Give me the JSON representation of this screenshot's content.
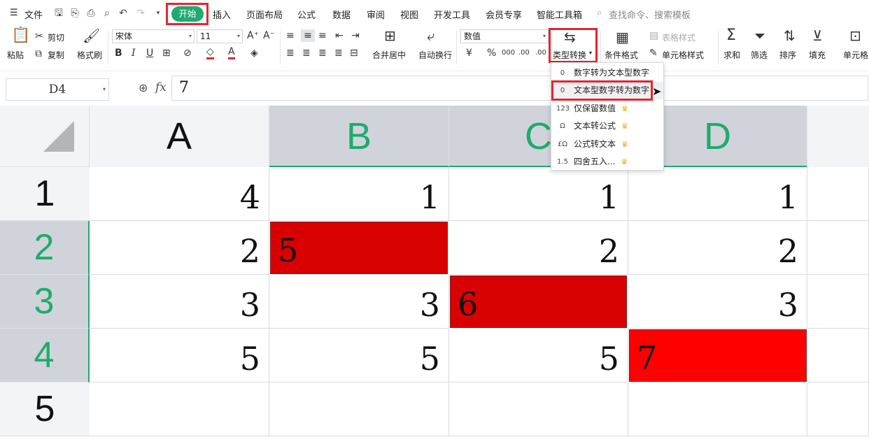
{
  "menubar": {
    "file_label": "文件",
    "tabs": [
      "开始",
      "插入",
      "页面布局",
      "公式",
      "数据",
      "审阅",
      "视图",
      "开发工具",
      "会员专享",
      "智能工具箱"
    ],
    "search_placeholder": "查找命令、搜索模板",
    "accent": "#1fab6d"
  },
  "ribbon": {
    "paste": "粘贴",
    "cut": "剪切",
    "copy": "复制",
    "format_painter": "格式刷",
    "font_name": "宋体",
    "font_size": "11",
    "merge_center": "合并居中",
    "wrap_text": "自动换行",
    "number_format": "数值",
    "currency": "¥",
    "percent": "%",
    "thousands": "000",
    "dec_inc": ".00",
    "dec_dec": ".00",
    "type_convert": "类型转换",
    "cond_format": "条件格式",
    "table_style": "表格样式",
    "cell_style": "单元格样式",
    "sum": "求和",
    "filter": "筛选",
    "sort": "排序",
    "fill": "填充",
    "cell": "单元格"
  },
  "formula_bar": {
    "name_box": "D4",
    "fx": "fx",
    "value": "7"
  },
  "grid": {
    "columns": [
      "A",
      "B",
      "C",
      "D"
    ],
    "rows": [
      "1",
      "2",
      "3",
      "4",
      "5"
    ],
    "cells": [
      [
        "4",
        "1",
        "1",
        "1"
      ],
      [
        "2",
        "5",
        "2",
        "2"
      ],
      [
        "3",
        "3",
        "6",
        "3"
      ],
      [
        "5",
        "5",
        "5",
        "7"
      ],
      [
        "",
        "",
        "",
        ""
      ]
    ],
    "highlight_color": "#d80000"
  },
  "dropdown": {
    "items": [
      {
        "label": "数字转为文本型数字",
        "icon": "0",
        "premium": false
      },
      {
        "label": "文本型数字转为数字",
        "icon": "0",
        "premium": false
      },
      {
        "label": "仅保留数值",
        "icon": "123",
        "premium": true
      },
      {
        "label": "文本转公式",
        "icon": "Ω",
        "premium": true
      },
      {
        "label": "公式转文本",
        "icon": "£Ω",
        "premium": true
      },
      {
        "label": "四舍五入...",
        "icon": "1.5",
        "premium": true
      }
    ]
  }
}
